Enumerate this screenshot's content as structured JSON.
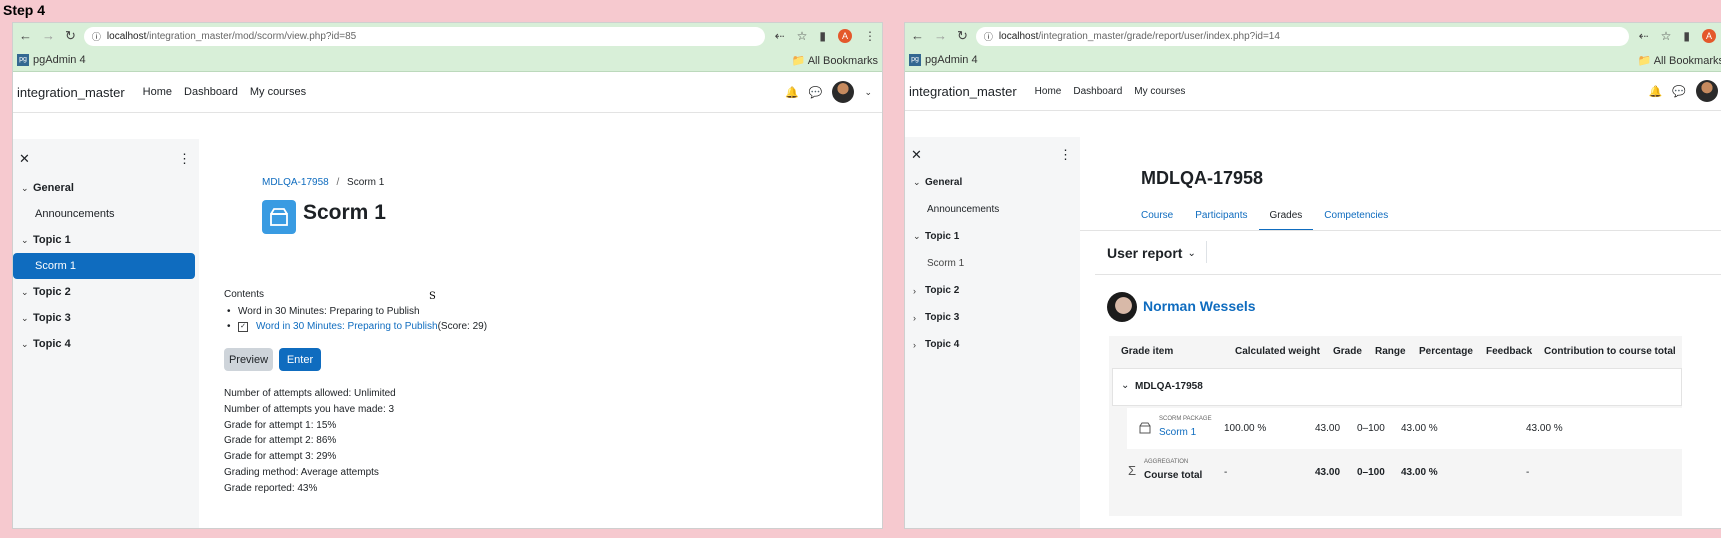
{
  "step_label": "Step 4",
  "left": {
    "url_host": "localhost",
    "url_path": "/integration_master/mod/scorm/view.php?id=85",
    "bookmark": "pgAdmin 4",
    "all_bookmarks": "All Bookmarks",
    "site_name": "integration_master",
    "nav": [
      "Home",
      "Dashboard",
      "My courses"
    ],
    "drawer": {
      "sections": [
        {
          "title": "General",
          "items": [
            "Announcements"
          ]
        },
        {
          "title": "Topic 1",
          "items": [
            "Scorm 1"
          ]
        },
        {
          "title": "Topic 2",
          "items": []
        },
        {
          "title": "Topic 3",
          "items": []
        },
        {
          "title": "Topic 4",
          "items": []
        }
      ]
    },
    "breadcrumb": {
      "course": "MDLQA-17958",
      "sep": "/",
      "current": "Scorm 1"
    },
    "title": "Scorm 1",
    "contents_label": "Contents",
    "content_items": [
      {
        "text": "Word in 30 Minutes: Preparing to Publish"
      },
      {
        "text": "Word in 30 Minutes: Preparing to Publish",
        "score": "(Score: 29)"
      }
    ],
    "stray_char": "S",
    "preview_label": "Preview",
    "enter_label": "Enter",
    "info": [
      "Number of attempts allowed: Unlimited",
      "Number of attempts you have made: 3",
      "Grade for attempt 1: 15%",
      "Grade for attempt 2: 86%",
      "Grade for attempt 3: 29%",
      "Grading method: Average attempts",
      "Grade reported: 43%"
    ]
  },
  "right": {
    "url_host": "localhost",
    "url_path": "/integration_master/grade/report/user/index.php?id=14",
    "bookmark": "pgAdmin 4",
    "all_bookmarks": "All Bookmarks",
    "site_name": "integration_master",
    "nav": [
      "Home",
      "Dashboard",
      "My courses"
    ],
    "drawer_sections": [
      "General",
      "Topic 1",
      "Topic 2",
      "Topic 3",
      "Topic 4"
    ],
    "drawer_items": {
      "announcements": "Announcements",
      "scorm1": "Scorm 1"
    },
    "course_title": "MDLQA-17958",
    "tabs": [
      "Course",
      "Participants",
      "Grades",
      "Competencies"
    ],
    "active_tab": "Grades",
    "report_selector": "User report",
    "user_name": "Norman Wessels",
    "table": {
      "headers": [
        "Grade item",
        "Calculated weight",
        "Grade",
        "Range",
        "Percentage",
        "Feedback",
        "Contribution to course total"
      ],
      "category": "MDLQA-17958",
      "item_type": "SCORM PACKAGE",
      "item_name": "Scorm 1",
      "item_weight": "100.00 %",
      "item_grade": "43.00",
      "item_range": "0–100",
      "item_percentage": "43.00 %",
      "item_contribution": "43.00 %",
      "total_type": "AGGREGATION",
      "total_name": "Course total",
      "total_weight": "-",
      "total_grade": "43.00",
      "total_range": "0–100",
      "total_percentage": "43.00 %",
      "total_contribution": "-"
    }
  },
  "colors": {
    "link": "#0f6cbf",
    "primary": "#0f6cbf",
    "chrome": "#d8efd8",
    "background": "#f6c9cf"
  }
}
